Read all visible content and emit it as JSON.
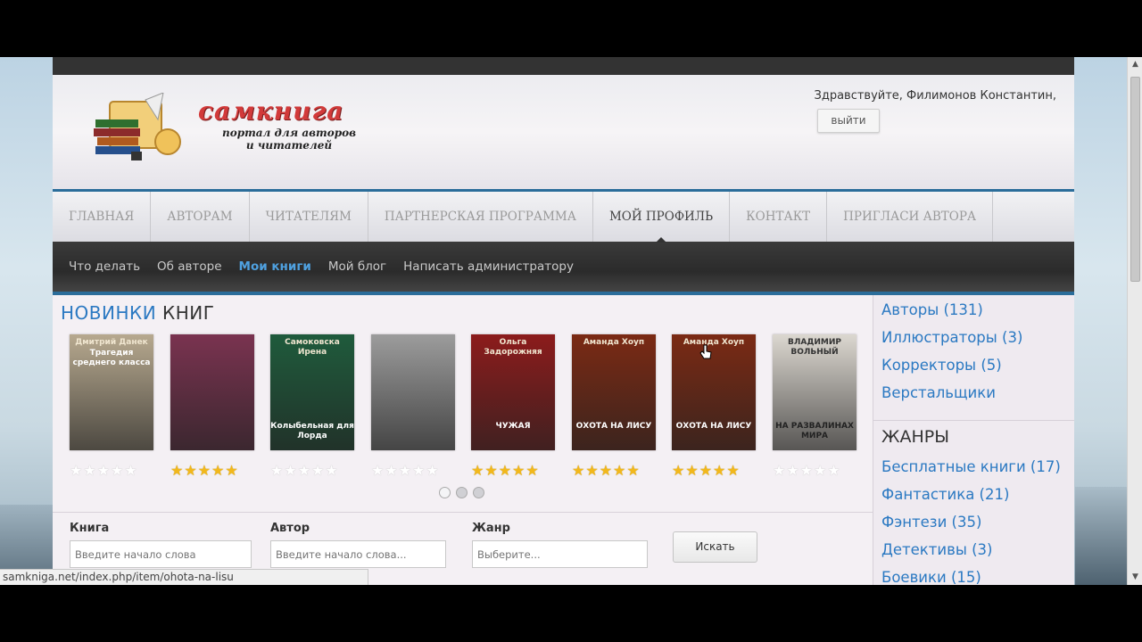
{
  "header": {
    "logo_title": "самкнига",
    "logo_subtitle_line1": "портал для авторов",
    "logo_subtitle_line2": "и читателей",
    "greeting": "Здравствуйте, Филимонов Константин,",
    "logout_label": "выйти"
  },
  "main_nav": [
    {
      "label": "Главная",
      "active": false
    },
    {
      "label": "Авторам",
      "active": false
    },
    {
      "label": "Читателям",
      "active": false
    },
    {
      "label": "Партнерская программа",
      "active": false
    },
    {
      "label": "Мой профиль",
      "active": true
    },
    {
      "label": "Контакт",
      "active": false
    },
    {
      "label": "Пригласи автора",
      "active": false
    }
  ],
  "sub_nav": [
    {
      "label": "Что делать",
      "active": false
    },
    {
      "label": "Об авторе",
      "active": false
    },
    {
      "label": "Мои книги",
      "active": true
    },
    {
      "label": "Мой блог",
      "active": false
    },
    {
      "label": "Написать администратору",
      "active": false
    }
  ],
  "new_books": {
    "title_part1": "НОВИНКИ",
    "title_part2": "КНИГ",
    "books": [
      {
        "cover_title": "Трагедия среднего класса",
        "cover_author": "Дмитрий Данек",
        "rating": 0,
        "cover_color": "#b7a98f"
      },
      {
        "cover_title": "",
        "cover_author": "",
        "rating": 5,
        "cover_color": "#7a3350"
      },
      {
        "cover_title": "Колыбельная для Лорда",
        "cover_author": "Самоковска Ирена",
        "rating": 0,
        "cover_color": "#1f5b3c"
      },
      {
        "cover_title": "",
        "cover_author": "",
        "rating": 0,
        "cover_color": "#9c9c9c"
      },
      {
        "cover_title": "ЧУЖАЯ",
        "cover_author": "Ольга Задорожняя",
        "rating": 5,
        "cover_color": "#8c1c1c"
      },
      {
        "cover_title": "ОХОТА НА ЛИСУ",
        "cover_author": "Аманда Хоуп",
        "rating": 5,
        "cover_color": "#7b2a14"
      },
      {
        "cover_title": "ОХОТА НА ЛИСУ",
        "cover_author": "Аманда Хоуп",
        "rating": 5,
        "cover_color": "#7b2a14"
      },
      {
        "cover_title": "НА РАЗВАЛИНАХ МИРА",
        "cover_author": "ВЛАДИМИР ВОЛЬНЫЙ",
        "rating": 0,
        "cover_color": "#dcd8d0"
      }
    ],
    "max_rating": 5,
    "carousel_pages": 3,
    "carousel_current": 1
  },
  "search": {
    "book_label": "Книга",
    "book_placeholder": "Введите начало слова",
    "author_label": "Автор",
    "author_placeholder": "Введите начало слова...",
    "genre_label": "Жанр",
    "genre_placeholder": "Выберите...",
    "button_label": "Искать"
  },
  "sidebar": {
    "people": [
      {
        "label": "Авторы (131)"
      },
      {
        "label": "Иллюстраторы (3)"
      },
      {
        "label": "Корректоры (5)"
      },
      {
        "label": "Верстальщики"
      }
    ],
    "genres_title": "ЖАНРЫ",
    "genres": [
      {
        "label": "Бесплатные книги (17)"
      },
      {
        "label": "Фантастика (21)"
      },
      {
        "label": "Фэнтези (35)"
      },
      {
        "label": "Детективы (3)"
      },
      {
        "label": "Боевики (15)"
      }
    ]
  },
  "status_bar": {
    "url": "samkniga.net/index.php/item/ohota-na-lisu"
  },
  "colors": {
    "accent_blue": "#2b79c2",
    "nav_border": "#2b6d9a",
    "star": "#f2b81b",
    "logo_red": "#d23a3a"
  }
}
